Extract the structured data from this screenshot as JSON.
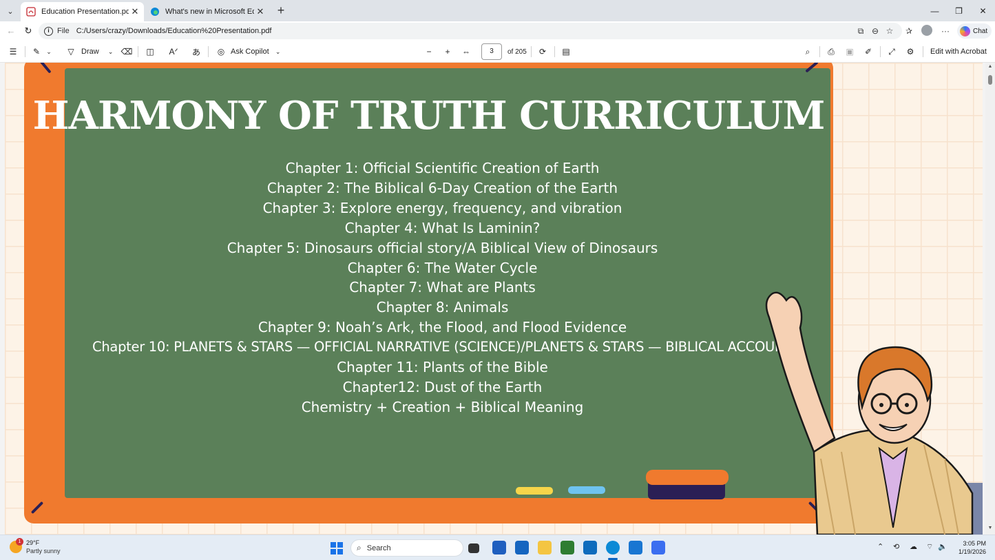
{
  "browser": {
    "tabs": [
      {
        "title": "Education Presentation.pdf",
        "active": true,
        "icon": "pdf-icon"
      },
      {
        "title": "What's new in Microsoft Edge",
        "active": false,
        "icon": "edge-icon"
      }
    ],
    "address": {
      "scheme": "File",
      "url": "C:/Users/crazy/Downloads/Education%20Presentation.pdf"
    },
    "chat_label": "Chat"
  },
  "pdf_toolbar": {
    "draw_label": "Draw",
    "ask_copilot_label": "Ask Copilot",
    "page_current": "3",
    "page_total": "of 205",
    "edit_acrobat_label": "Edit with Acrobat"
  },
  "slide": {
    "title": "HARMONY OF TRUTH CURRICULUM",
    "chapters": [
      "Chapter 1: Official Scientific Creation of Earth",
      "Chapter 2: The Biblical 6-Day Creation of the Earth",
      "Chapter 3: Explore energy, frequency, and vibration",
      "Chapter 4: What Is Laminin?",
      "Chapter 5: Dinosaurs official story/A Biblical View of Dinosaurs",
      "Chapter 6: The Water Cycle",
      "Chapter 7: What are Plants",
      "Chapter 8: Animals",
      "Chapter 9: Noah’s Ark, the Flood, and Flood Evidence",
      "Chapter 10: PLANETS & STARS — OFFICIAL NARRATIVE (SCIENCE)/PLANETS & STARS — BIBLICAL ACCOUNT",
      "Chapter 11: Plants of the Bible",
      "Chapter12: Dust of the Earth",
      "Chemistry + Creation + Biblical Meaning"
    ],
    "colors": {
      "frame": "#f07a2e",
      "board": "#5b8059",
      "text": "#ffffff"
    }
  },
  "taskbar": {
    "weather_temp": "29°F",
    "weather_desc": "Partly sunny",
    "weather_badge": "1",
    "search_placeholder": "Search",
    "time": "3:05 PM",
    "date": "1/19/2026"
  }
}
